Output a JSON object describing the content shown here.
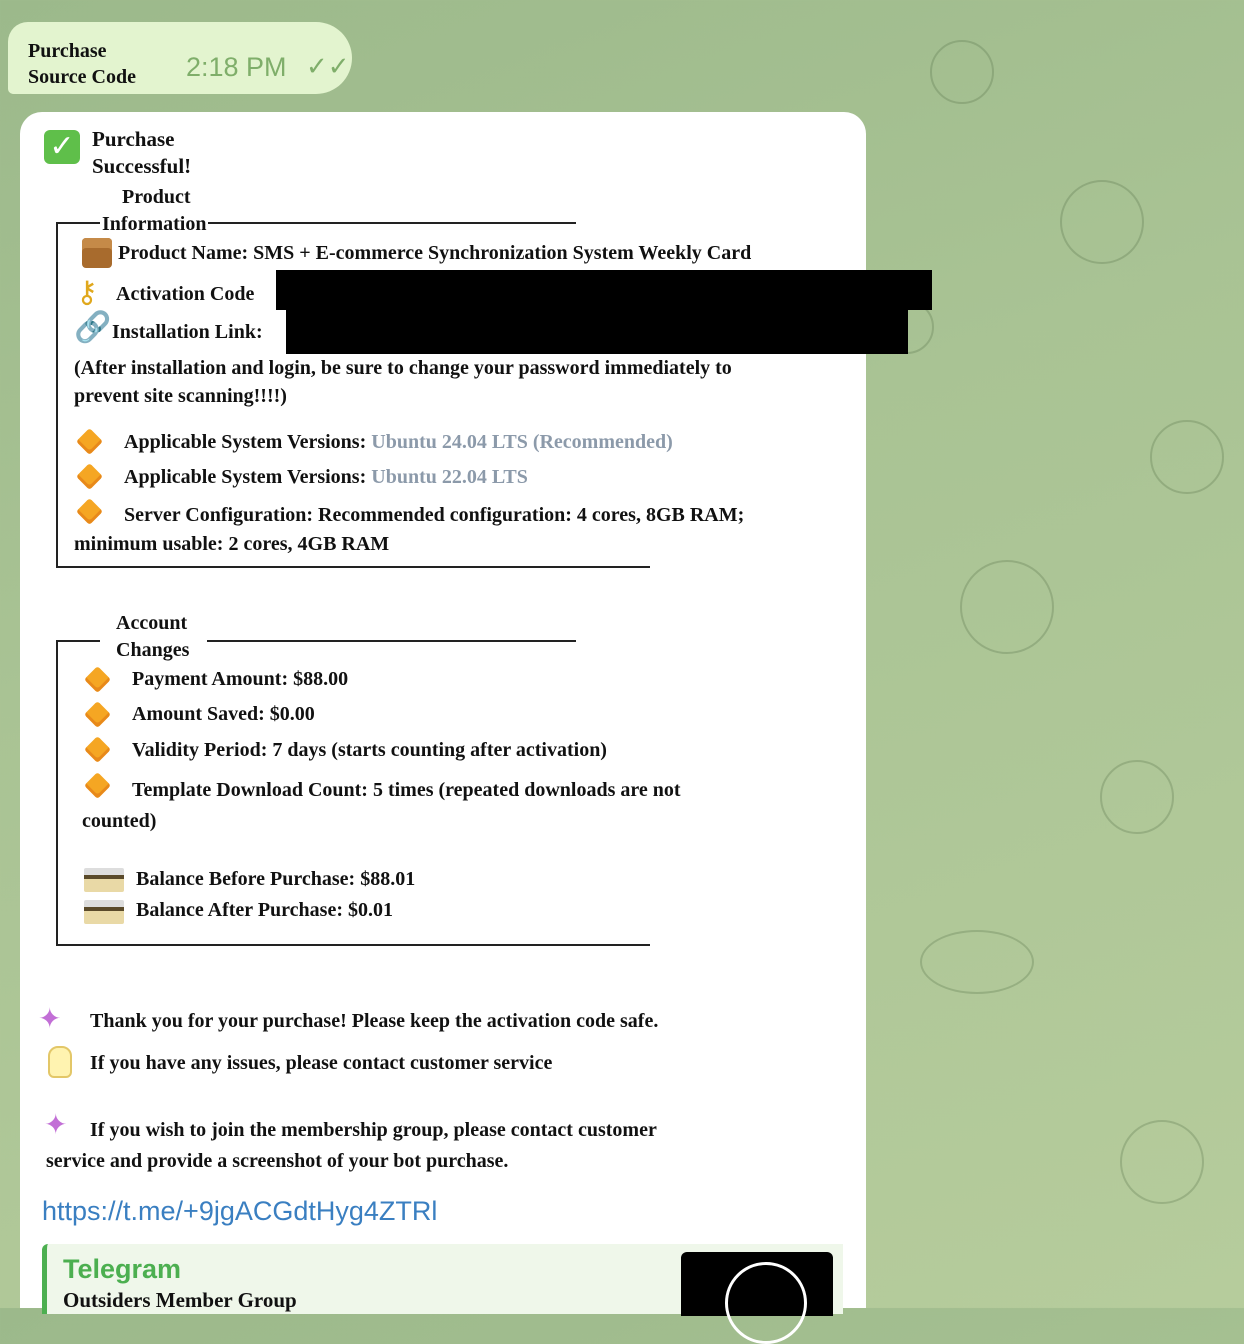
{
  "outgoing": {
    "text_line1": "Purchase",
    "text_line2": "Source Code",
    "time": "2:18 PM",
    "status_icon": "double-check-icon"
  },
  "message": {
    "header_line1": "Purchase",
    "header_line2": "Successful!",
    "product_section_line1": "Product",
    "product_section_line2": "Information",
    "product_name": "Product Name: SMS + E-commerce Synchronization System Weekly Card",
    "activation_code_label": "Activation Code",
    "installation_link_label": "Installation Link:",
    "warning_line1": "(After installation and login, be sure to change your password immediately to",
    "warning_line2": "prevent site scanning!!!!)",
    "versions_label": "Applicable System Versions:",
    "version1": "Ubuntu 24.04 LTS (Recommended)",
    "version2": "Ubuntu 22.04 LTS",
    "server_config_line1": "Server Configuration: Recommended configuration: 4 cores, 8GB RAM;",
    "server_config_line2": "minimum usable: 2 cores, 4GB RAM",
    "account_section_line1": "Account",
    "account_section_line2": "Changes",
    "payment_amount": "Payment Amount: $88.00",
    "amount_saved": "Amount Saved: $0.00",
    "validity_period": "Validity Period: 7 days (starts counting after activation)",
    "download_count_line1": "Template Download Count: 5 times (repeated downloads are not",
    "download_count_line2": "counted)",
    "balance_before": "Balance Before Purchase: $88.01",
    "balance_after": "Balance After Purchase: $0.01",
    "thanks": "Thank you for your purchase! Please keep the activation code safe.",
    "issues": "If you have any issues, please contact customer service",
    "membership_line1": "If you wish to join the membership group, please contact customer",
    "membership_line2": "service and provide a screenshot of your bot purchase.",
    "invite_link": "https://t.me/+9jgACGdtHyg4ZTRl"
  },
  "link_preview": {
    "site_name": "Telegram",
    "title": "Outsiders Member Group"
  },
  "colors": {
    "outgoing_bubble": "#e3f4cf",
    "link": "#3a7fc1",
    "preview_accent": "#4caf50",
    "muted_version": "#8c9aaa"
  }
}
